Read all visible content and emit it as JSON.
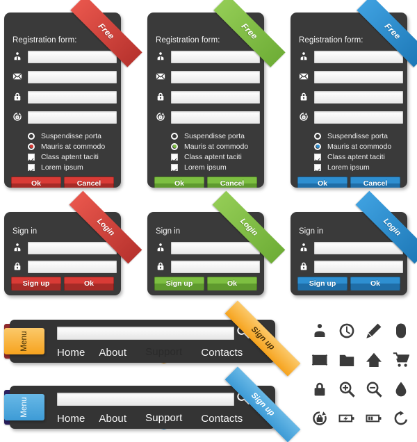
{
  "registration_cards": [
    {
      "id": "red",
      "ribbon_label": "Free",
      "title": "Registration form:",
      "accent": "#D93B36",
      "accent_dark": "#A62B27",
      "ribbon_from": "#E8564C",
      "ribbon_to": "#B8332E",
      "fields": [
        {
          "icon": "user-icon",
          "value": "",
          "placeholder": ""
        },
        {
          "icon": "envelope-icon",
          "value": "",
          "placeholder": ""
        },
        {
          "icon": "lock-icon",
          "value": "",
          "placeholder": ""
        },
        {
          "icon": "lock-refresh-icon",
          "value": "",
          "placeholder": ""
        }
      ],
      "options": [
        {
          "type": "radio",
          "label": "Suspendisse porta",
          "checked": false
        },
        {
          "type": "radio",
          "label": "Mauris at commodo",
          "checked": true
        },
        {
          "type": "checkbox",
          "label": "Class aptent taciti",
          "checked": true
        },
        {
          "type": "checkbox",
          "label": "Lorem ipsum",
          "checked": true
        }
      ],
      "buttons": [
        {
          "label": "Ok",
          "name": "ok-button"
        },
        {
          "label": "Cancel",
          "name": "cancel-button"
        }
      ]
    },
    {
      "id": "green",
      "ribbon_label": "Free",
      "title": "Registration form:",
      "accent": "#7DBF41",
      "accent_dark": "#5F9A2E",
      "ribbon_from": "#93CC55",
      "ribbon_to": "#6FAE37",
      "fields": [
        {
          "icon": "user-icon",
          "value": "",
          "placeholder": ""
        },
        {
          "icon": "envelope-icon",
          "value": "",
          "placeholder": ""
        },
        {
          "icon": "lock-icon",
          "value": "",
          "placeholder": ""
        },
        {
          "icon": "lock-refresh-icon",
          "value": "",
          "placeholder": ""
        }
      ],
      "options": [
        {
          "type": "radio",
          "label": "Suspendisse porta",
          "checked": false
        },
        {
          "type": "radio",
          "label": "Mauris at commodo",
          "checked": true
        },
        {
          "type": "checkbox",
          "label": "Class aptent taciti",
          "checked": true
        },
        {
          "type": "checkbox",
          "label": "Lorem ipsum",
          "checked": true
        }
      ],
      "buttons": [
        {
          "label": "Ok",
          "name": "ok-button"
        },
        {
          "label": "Cancel",
          "name": "cancel-button"
        }
      ]
    },
    {
      "id": "blue",
      "ribbon_label": "Free",
      "title": "Registration form:",
      "accent": "#2E8FD1",
      "accent_dark": "#1F6EA8",
      "ribbon_from": "#3EA0DF",
      "ribbon_to": "#1E79B8",
      "fields": [
        {
          "icon": "user-icon",
          "value": "",
          "placeholder": ""
        },
        {
          "icon": "envelope-icon",
          "value": "",
          "placeholder": ""
        },
        {
          "icon": "lock-icon",
          "value": "",
          "placeholder": ""
        },
        {
          "icon": "lock-refresh-icon",
          "value": "",
          "placeholder": ""
        }
      ],
      "options": [
        {
          "type": "radio",
          "label": "Suspendisse porta",
          "checked": false
        },
        {
          "type": "radio",
          "label": "Mauris at commodo",
          "checked": true
        },
        {
          "type": "checkbox",
          "label": "Class aptent taciti",
          "checked": true
        },
        {
          "type": "checkbox",
          "label": "Lorem ipsum",
          "checked": true
        }
      ],
      "buttons": [
        {
          "label": "Ok",
          "name": "ok-button"
        },
        {
          "label": "Cancel",
          "name": "cancel-button"
        }
      ]
    }
  ],
  "signin_cards": [
    {
      "id": "red",
      "ribbon_label": "Login",
      "title": "Sign in",
      "accent": "#D93B36",
      "accent_dark": "#A62B27",
      "ribbon_from": "#E8564C",
      "ribbon_to": "#B8332E",
      "fields": [
        {
          "icon": "user-icon",
          "value": "",
          "placeholder": ""
        },
        {
          "icon": "lock-icon",
          "value": "",
          "placeholder": ""
        }
      ],
      "buttons": [
        {
          "label": "Sign up",
          "name": "sign-up-button"
        },
        {
          "label": "Ok",
          "name": "ok-button"
        }
      ]
    },
    {
      "id": "green",
      "ribbon_label": "Login",
      "title": "Sign in",
      "accent": "#7DBF41",
      "accent_dark": "#5F9A2E",
      "ribbon_from": "#93CC55",
      "ribbon_to": "#6FAE37",
      "fields": [
        {
          "icon": "user-icon",
          "value": "",
          "placeholder": ""
        },
        {
          "icon": "lock-icon",
          "value": "",
          "placeholder": ""
        }
      ],
      "buttons": [
        {
          "label": "Sign up",
          "name": "sign-up-button"
        },
        {
          "label": "Ok",
          "name": "ok-button"
        }
      ]
    },
    {
      "id": "blue",
      "ribbon_label": "Login",
      "title": "Sign in",
      "accent": "#2E8FD1",
      "accent_dark": "#1F6EA8",
      "ribbon_from": "#3EA0DF",
      "ribbon_to": "#1E79B8",
      "fields": [
        {
          "icon": "user-icon",
          "value": "",
          "placeholder": ""
        },
        {
          "icon": "lock-icon",
          "value": "",
          "placeholder": ""
        }
      ],
      "buttons": [
        {
          "label": "Sign up",
          "name": "sign-up-button"
        },
        {
          "label": "Ok",
          "name": "ok-button"
        }
      ]
    }
  ],
  "menubars": [
    {
      "id": "orange",
      "menu_tab_label": "Menu",
      "search_value": "",
      "search_placeholder": "",
      "search_icon": "magnifier-icon",
      "signup_label": "Sign up",
      "accent": "#F6A31E",
      "accent_light": "#FBC96A",
      "tail_color": "#8E2A2E",
      "signup_text_color": "#4A3208",
      "tab_text_color": "#3A2A06",
      "links": [
        {
          "label": "Home",
          "active": false
        },
        {
          "label": "About",
          "active": false
        },
        {
          "label": "Support",
          "active": true
        },
        {
          "label": "Contacts",
          "active": false
        }
      ]
    },
    {
      "id": "blue",
      "menu_tab_label": "Menu",
      "search_value": "",
      "search_placeholder": "",
      "search_icon": "magnifier-icon",
      "signup_label": "Sign up",
      "accent": "#3D9BD6",
      "accent_light": "#68B8E6",
      "tail_color": "#2B1F5E",
      "signup_text_color": "#ffffff",
      "tab_text_color": "#ffffff",
      "links": [
        {
          "label": "Home",
          "active": false
        },
        {
          "label": "About",
          "active": false
        },
        {
          "label": "Support",
          "active": true
        },
        {
          "label": "Contacts",
          "active": false
        }
      ]
    }
  ],
  "icon_grid": {
    "color": "#3B3B3B",
    "icons": [
      "user-icon",
      "clock-icon",
      "pencil-icon",
      "mouse-icon",
      "envelope-icon",
      "folder-icon",
      "home-icon",
      "shopping-cart-icon",
      "lock-icon",
      "zoom-in-icon",
      "zoom-out-icon",
      "droplet-icon",
      "lock-refresh-icon",
      "battery-charging-icon",
      "battery-level-icon",
      "refresh-icon"
    ]
  }
}
